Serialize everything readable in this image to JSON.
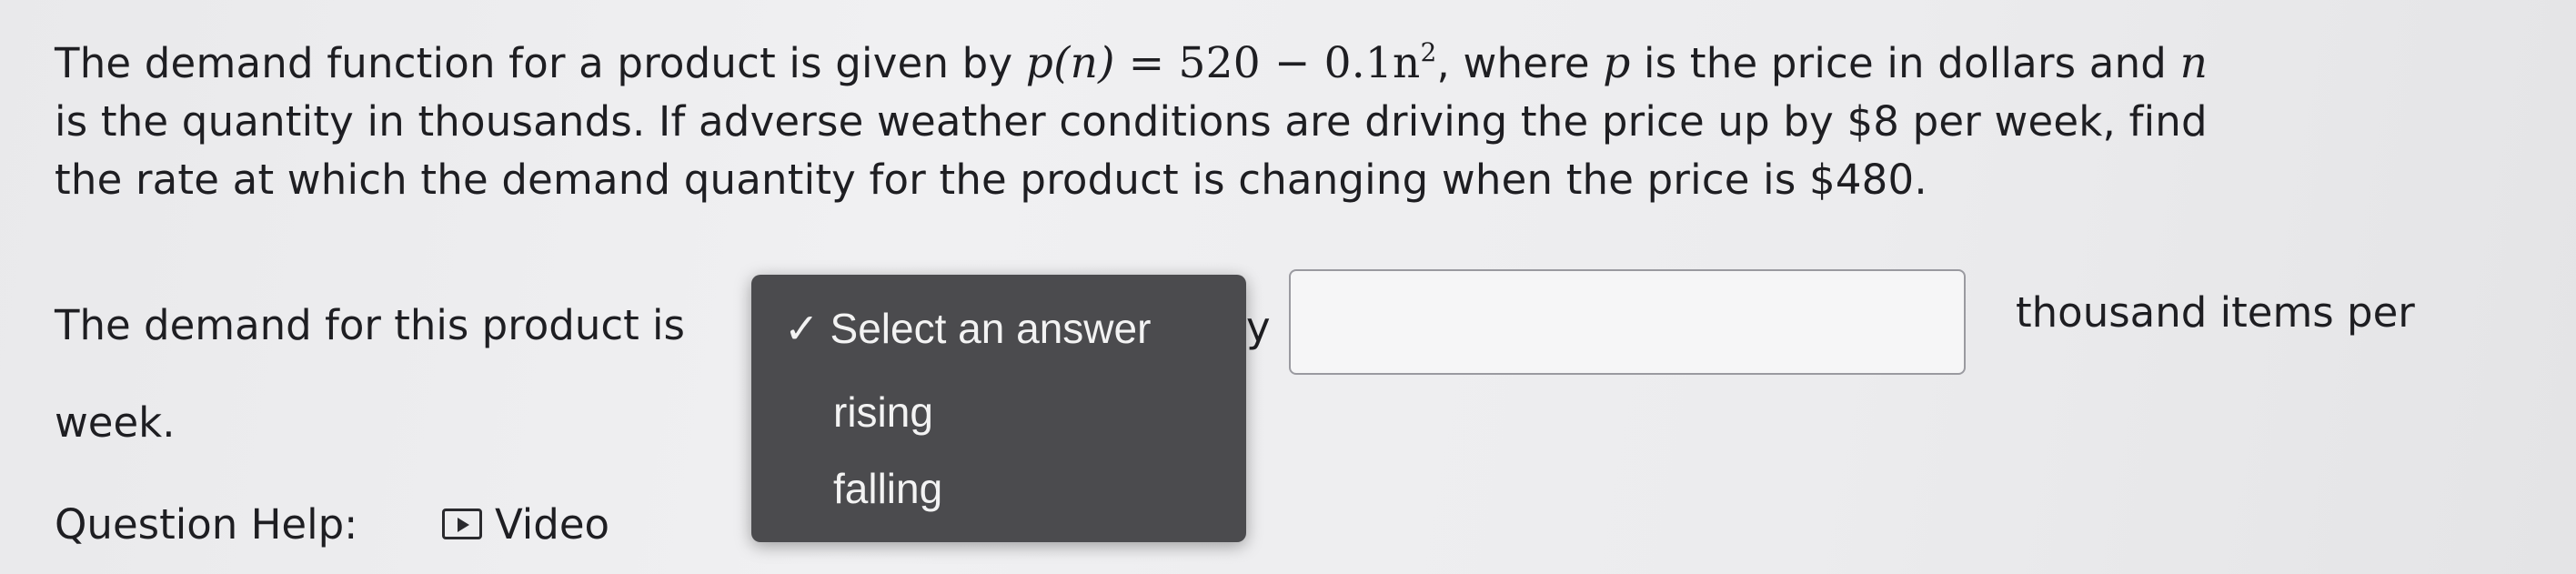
{
  "problem": {
    "line1_pre": "The demand function for a product is given by ",
    "eq_lhs": "p(n)",
    "eq_op": " = ",
    "eq_rhs": "520 − 0.1n",
    "eq_exp": "2",
    "line1_post": ", where ",
    "var_p": "p",
    "line1_post2": " is the price in dollars and ",
    "var_n": "n",
    "line2": "is the quantity in thousands. If adverse weather conditions are driving the price up by $8 per week, find",
    "line3": "the rate at which the demand quantity for the product is changing when the price is $480."
  },
  "answer": {
    "prefix": "The demand for this product is",
    "after_select": "y",
    "input_value": "",
    "suffix": "thousand items per",
    "suffix_cont": "week."
  },
  "dropdown": {
    "check_glyph": "✓",
    "selected": "Select an answer",
    "options": [
      "rising",
      "falling"
    ]
  },
  "help": {
    "label": "Question Help:",
    "video_label": "Video"
  }
}
